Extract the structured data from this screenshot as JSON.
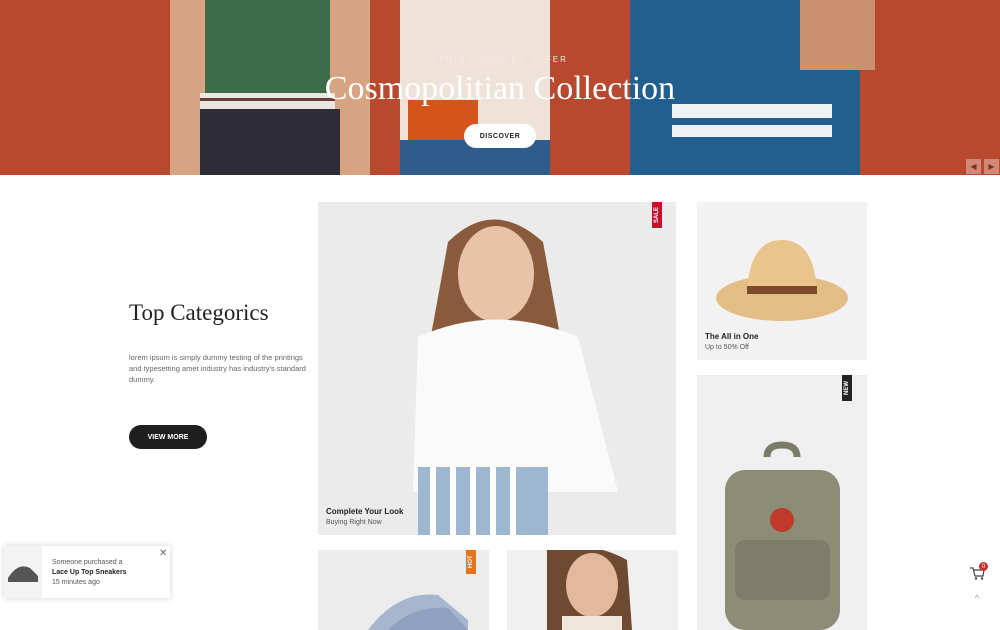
{
  "hero": {
    "subtitle": "SPRING SUMMER OFFER",
    "title": "Cosmopolitian Collection",
    "button_label": "DISCOVER",
    "prev_icon": "chevron-left-icon",
    "next_icon": "chevron-right-icon"
  },
  "intro": {
    "title": "Top Categorics",
    "description": "lorem ipsum is simply dummy testing of the printings and typesetting amet industry has industry's standard dummy.",
    "button_label": "VIEW MORE"
  },
  "cards": {
    "main": {
      "badge": "SALE",
      "title": "Complete Your Look",
      "subtitle": "Buying Right Now"
    },
    "hat": {
      "title": "The All in One",
      "subtitle": "Up to 50% Off"
    },
    "backpack": {
      "badge": "NEW"
    },
    "sneakers": {
      "badge": "HOT"
    }
  },
  "colors": {
    "hero_bg": "#b8492f",
    "sale_badge": "#c8102e",
    "hot_badge": "#e5731a",
    "new_badge": "#222222"
  },
  "notification": {
    "line1": "Someone purchased a",
    "product": "Lace Up Top Sneakers",
    "time": "15 minutes ago",
    "close_label": "✕"
  },
  "tools": {
    "cart_count": "0",
    "top_label": "^"
  }
}
